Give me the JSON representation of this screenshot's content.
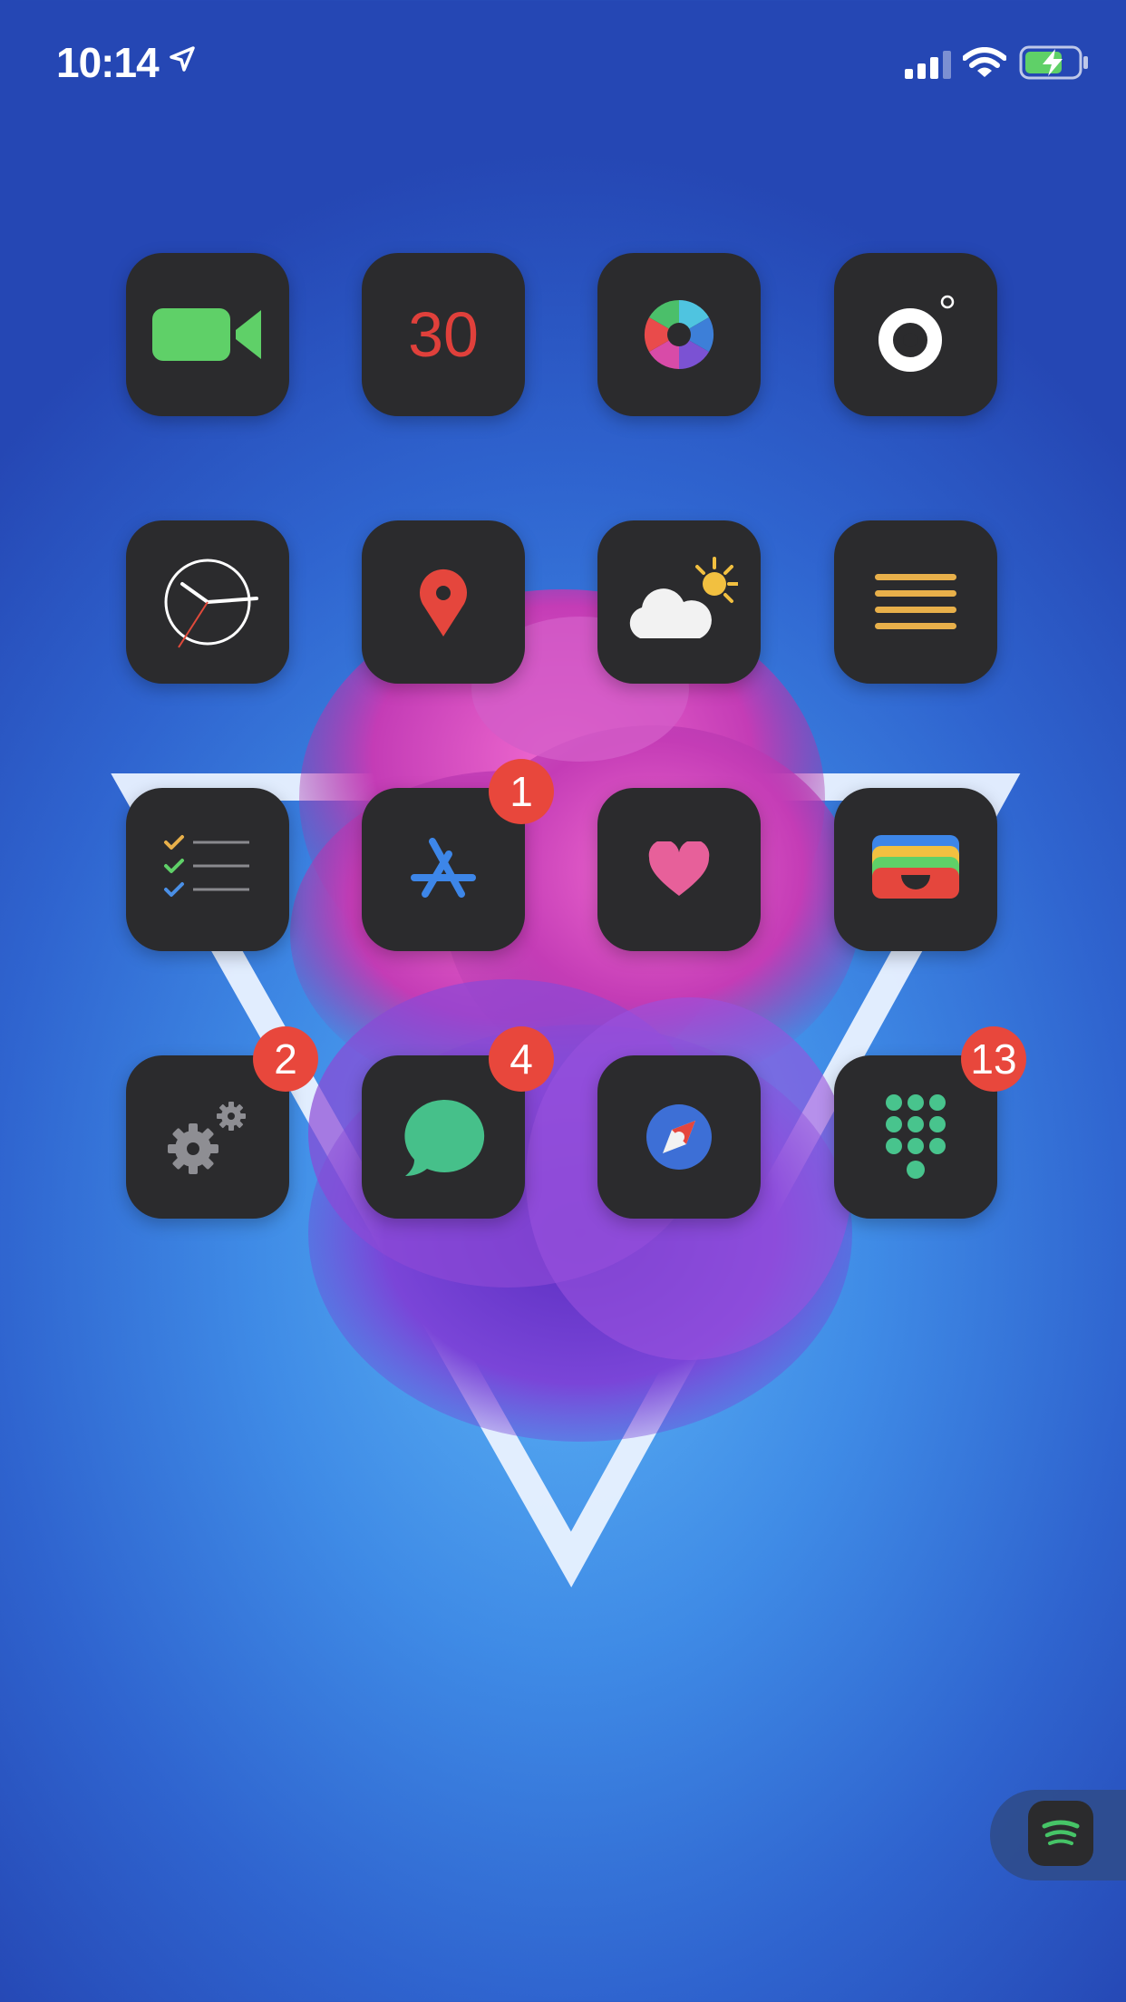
{
  "status_bar": {
    "time": "10:14"
  },
  "apps": [
    {
      "name": "facetime-icon"
    },
    {
      "name": "calendar-icon",
      "day": "30"
    },
    {
      "name": "photos-icon"
    },
    {
      "name": "camera-icon"
    },
    {
      "name": "clock-icon"
    },
    {
      "name": "maps-icon"
    },
    {
      "name": "weather-icon"
    },
    {
      "name": "notes-icon"
    },
    {
      "name": "reminders-icon"
    },
    {
      "name": "app-store-icon",
      "badge": "1"
    },
    {
      "name": "health-icon"
    },
    {
      "name": "wallet-icon"
    },
    {
      "name": "settings-icon",
      "badge": "2"
    },
    {
      "name": "messages-icon",
      "badge": "4"
    },
    {
      "name": "safari-icon"
    },
    {
      "name": "phone-icon",
      "badge": "13"
    }
  ],
  "dock": {
    "app": "spotify-icon"
  },
  "colors": {
    "badge": "#e8473c",
    "icon_bg": "#2b2b2d",
    "facetime": "#5fd068",
    "maps_pin": "#e5463d",
    "notes_lines": "#e8b04a",
    "health_heart": "#e7609a",
    "messages": "#46c08a",
    "phone_dots": "#48c48d"
  }
}
